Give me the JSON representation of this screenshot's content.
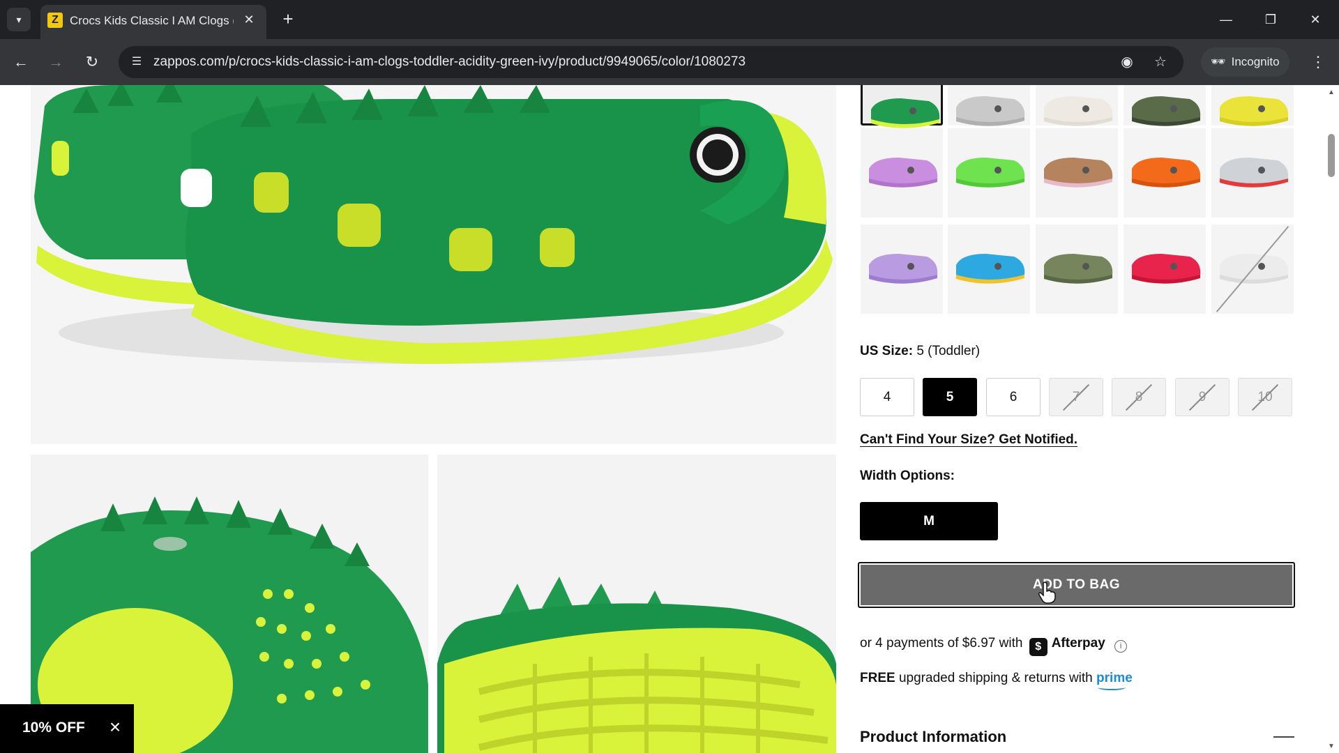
{
  "browser": {
    "tab_title": "Crocs Kids Classic I AM Clogs (T",
    "favicon_letter": "Z",
    "url": "zappos.com/p/crocs-kids-classic-i-am-clogs-toddler-acidity-green-ivy/product/9949065/color/1080273",
    "incognito_label": "Incognito"
  },
  "product": {
    "swatch_colors": [
      {
        "name": "green",
        "upper": "#1f9a4e",
        "sole": "#d9f23a"
      },
      {
        "name": "grey",
        "upper": "#c9c9c9",
        "sole": "#b0b0b0"
      },
      {
        "name": "white",
        "upper": "#eeeae3",
        "sole": "#e2ddd4"
      },
      {
        "name": "camo",
        "upper": "#5a6b4a",
        "sole": "#3d4a33"
      },
      {
        "name": "yellow",
        "upper": "#e9e33a",
        "sole": "#d6cf1f"
      },
      {
        "name": "purple",
        "upper": "#c98ee0",
        "sole": "#b273cc"
      },
      {
        "name": "lime",
        "upper": "#6fe34f",
        "sole": "#52c937"
      },
      {
        "name": "brown-pink",
        "upper": "#b5845f",
        "sole": "#e7b9c9"
      },
      {
        "name": "orange",
        "upper": "#f36a1b",
        "sole": "#d9520a"
      },
      {
        "name": "grey-red",
        "upper": "#cfd3d8",
        "sole": "#e23b3b"
      },
      {
        "name": "lavender",
        "upper": "#b89be0",
        "sole": "#9d7bd0"
      },
      {
        "name": "blue",
        "upper": "#2ea8e0",
        "sole": "#f2c22e"
      },
      {
        "name": "olive",
        "upper": "#76855c",
        "sole": "#5b6846"
      },
      {
        "name": "red",
        "upper": "#e8244c",
        "sole": "#c81437"
      },
      {
        "name": "white-out",
        "upper": "#ececec",
        "sole": "#dcdcdc"
      }
    ],
    "size_label": "US Size:",
    "size_value": "5 (Toddler)",
    "sizes": [
      {
        "label": "4",
        "state": "available"
      },
      {
        "label": "5",
        "state": "selected"
      },
      {
        "label": "6",
        "state": "available"
      },
      {
        "label": "7",
        "state": "unavailable"
      },
      {
        "label": "8",
        "state": "unavailable"
      },
      {
        "label": "9",
        "state": "unavailable"
      },
      {
        "label": "10",
        "state": "unavailable"
      }
    ],
    "notify_link": "Can't Find Your Size? Get Notified.",
    "width_label": "Width Options:",
    "width_value": "M",
    "add_to_bag": "ADD TO BAG",
    "afterpay_text": "or 4 payments of $6.97 with",
    "afterpay_name": "Afterpay",
    "shipping_free": "FREE",
    "shipping_text": "upgraded shipping & returns with",
    "prime": "prime",
    "product_info_heading": "Product Information"
  },
  "promo": {
    "label": "10% OFF"
  },
  "colors": {
    "shoe_green": "#1f9a4e",
    "shoe_sole": "#d9f23a",
    "button_gray": "#6a6a6a",
    "prime_blue": "#1a8cd8"
  }
}
